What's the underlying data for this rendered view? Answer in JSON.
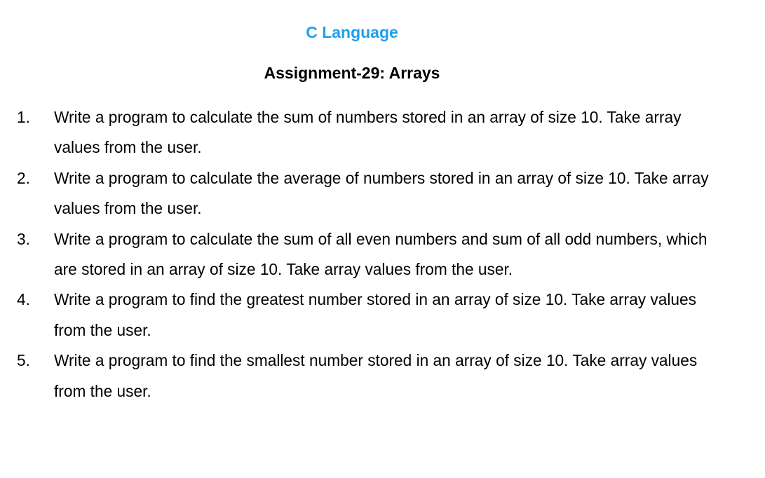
{
  "header": {
    "course": "C Language",
    "assignment": "Assignment-29: Arrays"
  },
  "colors": {
    "course_title": "#1ea0f0",
    "text": "#000000"
  },
  "questions": [
    {
      "number": "1.",
      "text": "Write a program to calculate the sum of numbers stored in an array of size 10. Take array values from the user."
    },
    {
      "number": "2.",
      "text": "Write a program to calculate the average of numbers stored in an array of size 10. Take array values from the user."
    },
    {
      "number": "3.",
      "text": "Write a program to calculate the sum of all even numbers and sum of all odd numbers, which are stored in an array of size 10. Take array values from the user."
    },
    {
      "number": "4.",
      "text": "Write a program to find the greatest number stored in an array of size 10. Take array values from the user."
    },
    {
      "number": "5.",
      "text": "Write a program to find the smallest number stored in an array of size 10. Take array values from the user."
    }
  ]
}
